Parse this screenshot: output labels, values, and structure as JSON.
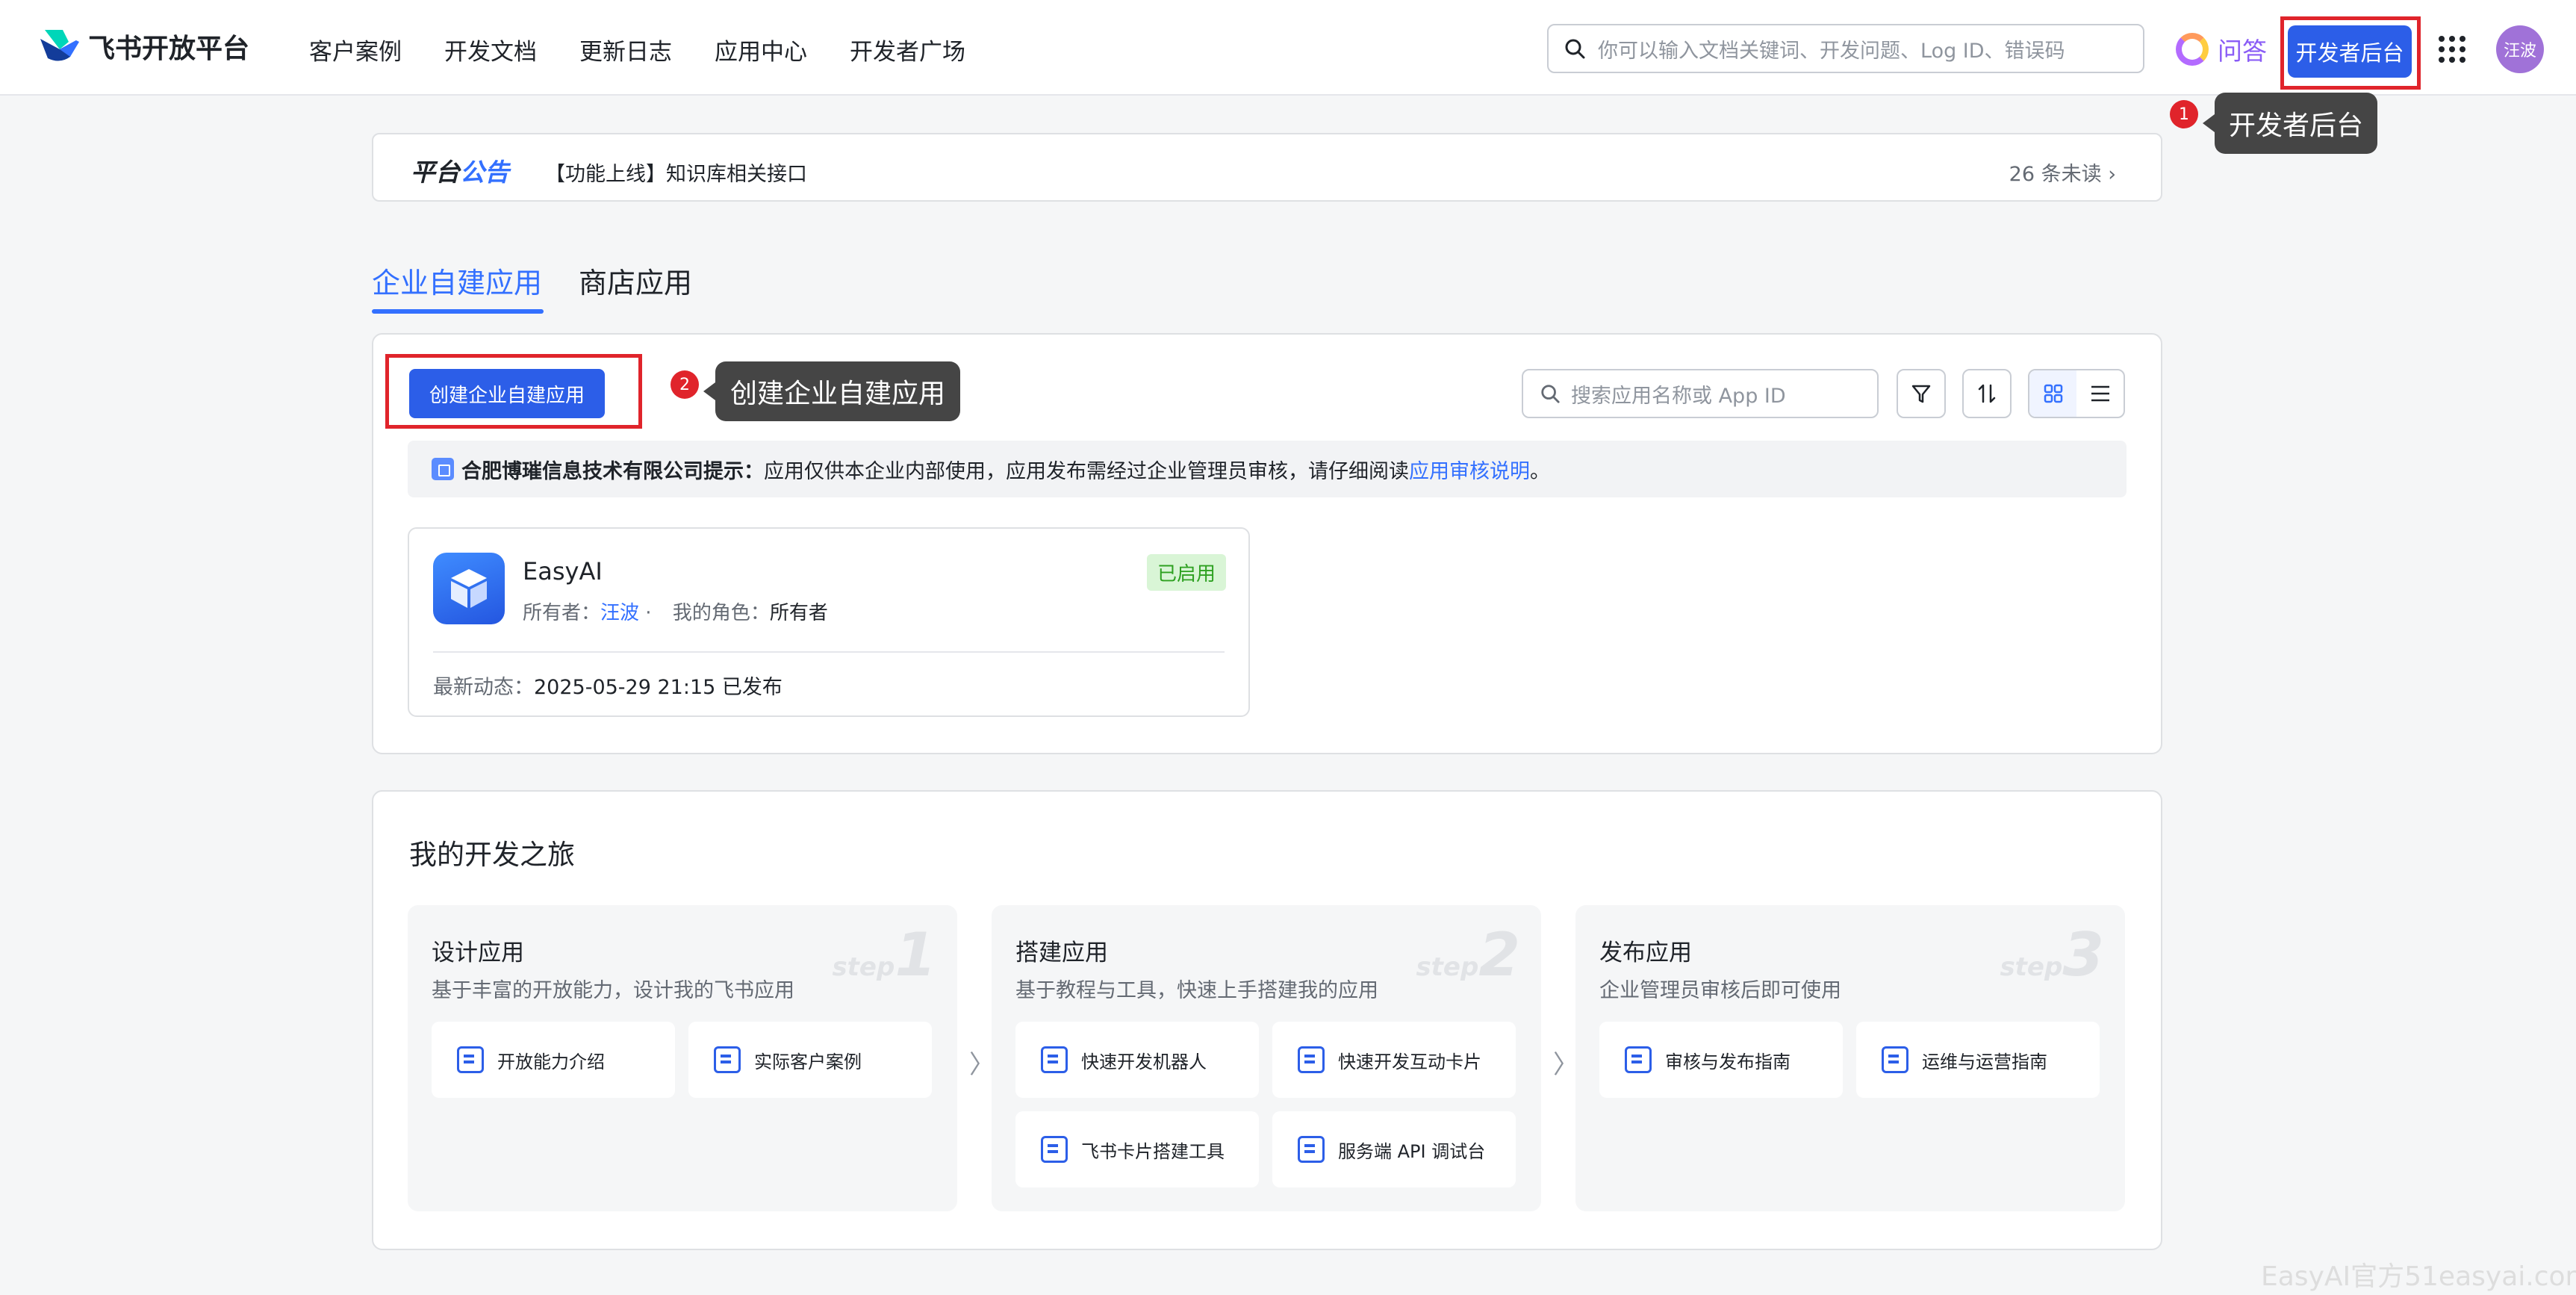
{
  "header": {
    "brand": "飞书开放平台",
    "nav": [
      "客户案例",
      "开发文档",
      "更新日志",
      "应用中心",
      "开发者广场"
    ],
    "search_placeholder": "你可以输入文档关键词、开发问题、Log ID、错误码",
    "qa_label": "问答",
    "dev_console_label": "开发者后台",
    "avatar_text": "汪波"
  },
  "callouts": [
    {
      "number": "1",
      "text": "开发者后台"
    },
    {
      "number": "2",
      "text": "创建企业自建应用"
    }
  ],
  "announcement": {
    "title_a": "平台",
    "title_b": "公告",
    "text": "【功能上线】知识库相关接口",
    "unread": "26 条未读 ›"
  },
  "tabs": {
    "active": "企业自建应用",
    "inactive": "商店应用"
  },
  "main": {
    "create_button": "创建企业自建应用",
    "search_placeholder": "搜索应用名称或 App ID",
    "notice_company": "合肥博璀信息技术有限公司提示：",
    "notice_text": "应用仅供本企业内部使用，应用发布需经过企业管理员审核，请仔细阅读 ",
    "notice_link": "应用审核说明",
    "notice_end": "。"
  },
  "app": {
    "name": "EasyAI",
    "owner_label": "所有者：",
    "owner": "汪波",
    "sep": " · ",
    "role_label": "我的角色：",
    "role": "所有者",
    "status": "已启用",
    "latest_label": "最新动态：",
    "latest_value": "2025-05-29 21:15 已发布"
  },
  "journey": {
    "title": "我的开发之旅",
    "steps": [
      {
        "title": "设计应用",
        "desc": "基于丰富的开放能力，设计我的飞书应用",
        "step_word": "step",
        "step_num": "1",
        "tools": [
          "开放能力介绍",
          "实际客户案例"
        ]
      },
      {
        "title": "搭建应用",
        "desc": "基于教程与工具，快速上手搭建我的应用",
        "step_word": "step",
        "step_num": "2",
        "tools": [
          "快速开发机器人",
          "快速开发互动卡片",
          "飞书卡片搭建工具",
          "服务端 API 调试台"
        ]
      },
      {
        "title": "发布应用",
        "desc": "企业管理员审核后即可使用",
        "step_word": "step",
        "step_num": "3",
        "tools": [
          "审核与发布指南",
          "运维与运营指南"
        ]
      }
    ],
    "arrow": "〉"
  },
  "watermark": "EasyAI官方51easyai.com",
  "colors": {
    "primary": "#2c5ee8",
    "link": "#3370ff",
    "highlight": "#e0242b",
    "tooltip": "#454545",
    "success_bg": "#d9f5d6",
    "success_text": "#2ea121"
  }
}
